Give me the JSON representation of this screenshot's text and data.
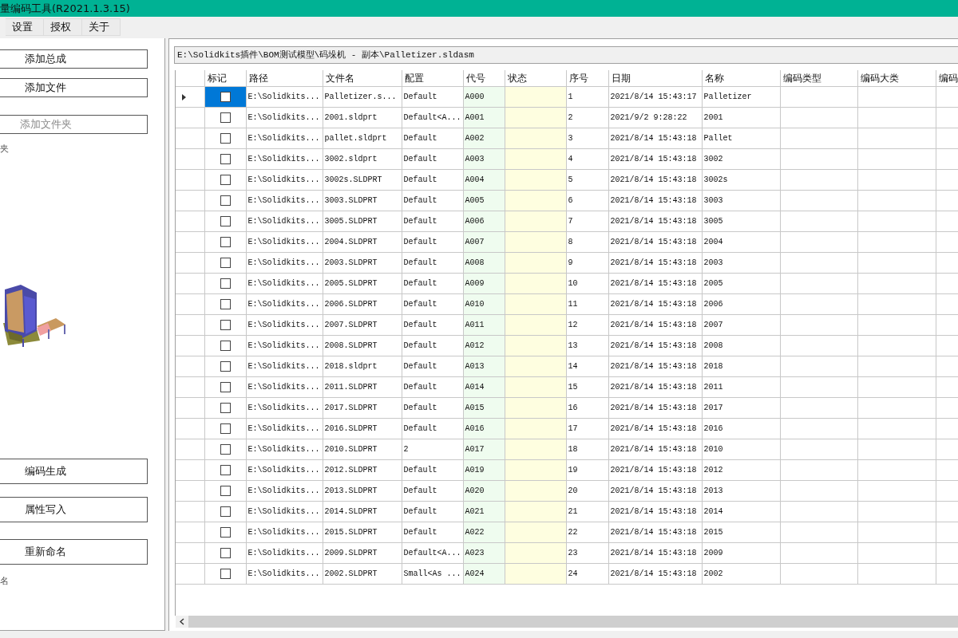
{
  "window": {
    "title": "量编码工具(R2021.1.3.15)"
  },
  "menu": [
    {
      "label": "设置"
    },
    {
      "label": "授权"
    },
    {
      "label": "关于"
    }
  ],
  "side_panel": {
    "items": [
      {
        "kind": "button",
        "label": "添加总成",
        "disabled": false
      },
      {
        "kind": "button",
        "label": "添加文件",
        "disabled": false
      },
      {
        "kind": "button",
        "label": "添加文件夹",
        "disabled": true
      },
      {
        "kind": "label",
        "label": "夹"
      },
      {
        "kind": "picture"
      },
      {
        "kind": "button",
        "label": "编码生成",
        "disabled": false
      },
      {
        "kind": "button",
        "label": "属性写入",
        "disabled": false
      },
      {
        "kind": "button",
        "label": "重新命名",
        "disabled": false
      },
      {
        "kind": "label",
        "label": "名"
      }
    ]
  },
  "path_field": {
    "value": "E:\\Solidkits插件\\BOM测试模型\\码垛机 - 副本\\Palletizer.sldasm"
  },
  "table": {
    "columns": [
      "标记",
      "路径",
      "文件名",
      "配置",
      "代号",
      "状态",
      "序号",
      "日期",
      "名称",
      "编码类型",
      "编码大类",
      "编码"
    ],
    "rows": [
      {
        "selected": true,
        "checked": false,
        "cells": [
          "",
          "E:\\Solidkits...",
          "Palletizer.s...",
          "Default",
          "A000",
          "",
          "1",
          "2021/8/14 15:43:17",
          "Palletizer"
        ]
      },
      {
        "selected": false,
        "checked": false,
        "cells": [
          "",
          "E:\\Solidkits...",
          "2001.sldprt",
          "Default<A...",
          "A001",
          "",
          "2",
          "2021/9/2 9:28:22",
          "2001"
        ]
      },
      {
        "selected": false,
        "checked": false,
        "cells": [
          "",
          "E:\\Solidkits...",
          "pallet.sldprt",
          "Default",
          "A002",
          "",
          "3",
          "2021/8/14 15:43:18",
          "Pallet"
        ]
      },
      {
        "selected": false,
        "checked": false,
        "cells": [
          "",
          "E:\\Solidkits...",
          "3002.sldprt",
          "Default",
          "A003",
          "",
          "4",
          "2021/8/14 15:43:18",
          "3002"
        ]
      },
      {
        "selected": false,
        "checked": false,
        "cells": [
          "",
          "E:\\Solidkits...",
          "3002s.SLDPRT",
          "Default",
          "A004",
          "",
          "5",
          "2021/8/14 15:43:18",
          "3002s"
        ]
      },
      {
        "selected": false,
        "checked": false,
        "cells": [
          "",
          "E:\\Solidkits...",
          "3003.SLDPRT",
          "Default",
          "A005",
          "",
          "6",
          "2021/8/14 15:43:18",
          "3003"
        ]
      },
      {
        "selected": false,
        "checked": false,
        "cells": [
          "",
          "E:\\Solidkits...",
          "3005.SLDPRT",
          "Default",
          "A006",
          "",
          "7",
          "2021/8/14 15:43:18",
          "3005"
        ]
      },
      {
        "selected": false,
        "checked": false,
        "cells": [
          "",
          "E:\\Solidkits...",
          "2004.SLDPRT",
          "Default",
          "A007",
          "",
          "8",
          "2021/8/14 15:43:18",
          "2004"
        ]
      },
      {
        "selected": false,
        "checked": false,
        "cells": [
          "",
          "E:\\Solidkits...",
          "2003.SLDPRT",
          "Default",
          "A008",
          "",
          "9",
          "2021/8/14 15:43:18",
          "2003"
        ]
      },
      {
        "selected": false,
        "checked": false,
        "cells": [
          "",
          "E:\\Solidkits...",
          "2005.SLDPRT",
          "Default",
          "A009",
          "",
          "10",
          "2021/8/14 15:43:18",
          "2005"
        ]
      },
      {
        "selected": false,
        "checked": false,
        "cells": [
          "",
          "E:\\Solidkits...",
          "2006.SLDPRT",
          "Default",
          "A010",
          "",
          "11",
          "2021/8/14 15:43:18",
          "2006"
        ]
      },
      {
        "selected": false,
        "checked": false,
        "cells": [
          "",
          "E:\\Solidkits...",
          "2007.SLDPRT",
          "Default",
          "A011",
          "",
          "12",
          "2021/8/14 15:43:18",
          "2007"
        ]
      },
      {
        "selected": false,
        "checked": false,
        "cells": [
          "",
          "E:\\Solidkits...",
          "2008.SLDPRT",
          "Default",
          "A012",
          "",
          "13",
          "2021/8/14 15:43:18",
          "2008"
        ]
      },
      {
        "selected": false,
        "checked": false,
        "cells": [
          "",
          "E:\\Solidkits...",
          "2018.sldprt",
          "Default",
          "A013",
          "",
          "14",
          "2021/8/14 15:43:18",
          "2018"
        ]
      },
      {
        "selected": false,
        "checked": false,
        "cells": [
          "",
          "E:\\Solidkits...",
          "2011.SLDPRT",
          "Default",
          "A014",
          "",
          "15",
          "2021/8/14 15:43:18",
          "2011"
        ]
      },
      {
        "selected": false,
        "checked": false,
        "cells": [
          "",
          "E:\\Solidkits...",
          "2017.SLDPRT",
          "Default",
          "A015",
          "",
          "16",
          "2021/8/14 15:43:18",
          "2017"
        ]
      },
      {
        "selected": false,
        "checked": false,
        "cells": [
          "",
          "E:\\Solidkits...",
          "2016.SLDPRT",
          "Default",
          "A016",
          "",
          "17",
          "2021/8/14 15:43:18",
          "2016"
        ]
      },
      {
        "selected": false,
        "checked": false,
        "cells": [
          "",
          "E:\\Solidkits...",
          "2010.SLDPRT",
          "2",
          "A017",
          "",
          "18",
          "2021/8/14 15:43:18",
          "2010"
        ]
      },
      {
        "selected": false,
        "checked": false,
        "cells": [
          "",
          "E:\\Solidkits...",
          "2012.SLDPRT",
          "Default",
          "A019",
          "",
          "19",
          "2021/8/14 15:43:18",
          "2012"
        ]
      },
      {
        "selected": false,
        "checked": false,
        "cells": [
          "",
          "E:\\Solidkits...",
          "2013.SLDPRT",
          "Default",
          "A020",
          "",
          "20",
          "2021/8/14 15:43:18",
          "2013"
        ]
      },
      {
        "selected": false,
        "checked": false,
        "cells": [
          "",
          "E:\\Solidkits...",
          "2014.SLDPRT",
          "Default",
          "A021",
          "",
          "21",
          "2021/8/14 15:43:18",
          "2014"
        ]
      },
      {
        "selected": false,
        "checked": false,
        "cells": [
          "",
          "E:\\Solidkits...",
          "2015.SLDPRT",
          "Default",
          "A022",
          "",
          "22",
          "2021/8/14 15:43:18",
          "2015"
        ]
      },
      {
        "selected": false,
        "checked": false,
        "cells": [
          "",
          "E:\\Solidkits...",
          "2009.SLDPRT",
          "Default<A...",
          "A023",
          "",
          "23",
          "2021/8/14 15:43:18",
          "2009"
        ]
      },
      {
        "selected": false,
        "checked": false,
        "cells": [
          "",
          "E:\\Solidkits...",
          "2002.SLDPRT",
          "Small<As ...",
          "A024",
          "",
          "24",
          "2021/8/14 15:43:18",
          "2002"
        ]
      }
    ]
  }
}
